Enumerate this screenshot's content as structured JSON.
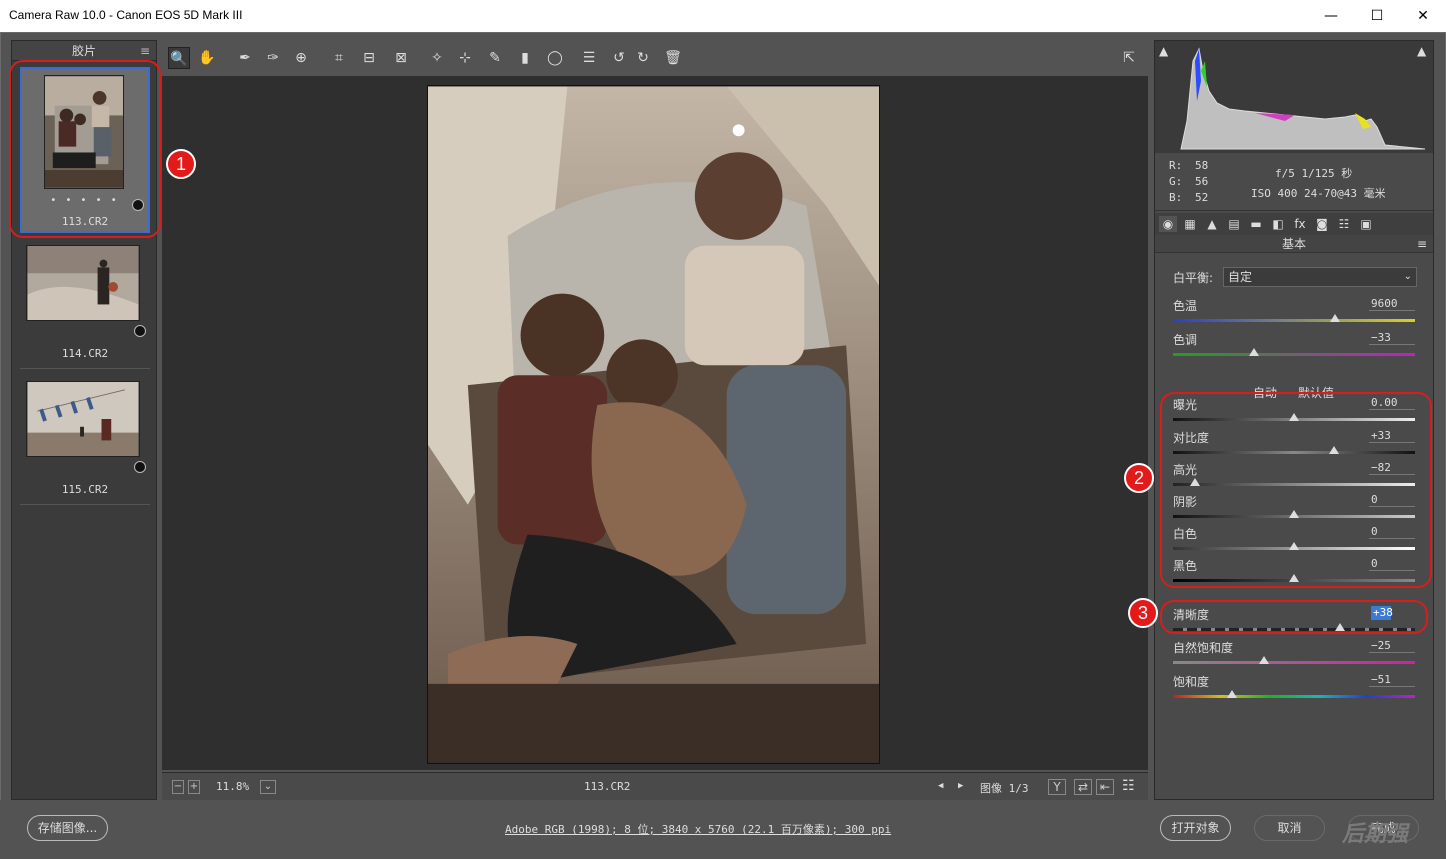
{
  "window": {
    "title": "Camera Raw 10.0 -  Canon EOS 5D Mark III",
    "minimize": "—",
    "maximize": "☐",
    "close": "✕"
  },
  "filmstrip": {
    "header": "胶片",
    "menu_icon": "≡",
    "items": [
      {
        "label": "113.CR2",
        "dots": "• • • • •"
      },
      {
        "label": "114.CR2"
      },
      {
        "label": "115.CR2"
      }
    ]
  },
  "toolbar": {
    "tools": [
      {
        "icon": "zoom-icon",
        "glyph": "🔍"
      },
      {
        "icon": "hand-icon",
        "glyph": "✋"
      },
      {
        "icon": "white-balance-icon",
        "glyph": "✒"
      },
      {
        "icon": "color-sampler-icon",
        "glyph": "✑"
      },
      {
        "icon": "targeted-adjust-icon",
        "glyph": "⊕"
      },
      {
        "icon": "crop-icon",
        "glyph": "⌗"
      },
      {
        "icon": "straighten-icon",
        "glyph": "⊟"
      },
      {
        "icon": "transform-icon",
        "glyph": "⊠"
      },
      {
        "icon": "spot-removal-icon",
        "glyph": "✧"
      },
      {
        "icon": "red-eye-icon",
        "glyph": "⊹"
      },
      {
        "icon": "adjustment-brush-icon",
        "glyph": "✎"
      },
      {
        "icon": "graduated-filter-icon",
        "glyph": "▮"
      },
      {
        "icon": "radial-filter-icon",
        "glyph": "◯"
      },
      {
        "icon": "preferences-icon",
        "glyph": "☰"
      },
      {
        "icon": "rotate-ccw-icon",
        "glyph": "↺"
      },
      {
        "icon": "rotate-cw-icon",
        "glyph": "↻"
      },
      {
        "icon": "trash-icon",
        "glyph": "🗑"
      }
    ],
    "fullscreen_glyph": "⇱"
  },
  "status": {
    "zoom_out": "−",
    "zoom_in": "+",
    "zoom": "11.8%",
    "zoom_chevron": "⌄",
    "filename": "113.CR2",
    "prev": "◀",
    "next": "▶",
    "image_counter": "图像 1/3",
    "view_y": "Y",
    "view_swap": "⇄",
    "view_copy": "⇤",
    "view_settings": "☷"
  },
  "info": {
    "r_label": "R:",
    "r": "58",
    "g_label": "G:",
    "g": "56",
    "b_label": "B:",
    "b": "52",
    "aperture_shutter": "f/5  1/125 秒",
    "iso_lens": "ISO 400  24-70@43 毫米"
  },
  "histogram_clip_left": "▲",
  "histogram_clip_right": "▲",
  "panel": {
    "tabs": [
      "◉",
      "▦",
      "▲",
      "▤",
      "▬",
      "◧",
      "fx",
      "◙",
      "☷",
      "▣"
    ],
    "title": "基本",
    "menu": "≡",
    "white_balance_label": "白平衡:",
    "white_balance_value": "自定",
    "wb_chevron": "⌄",
    "auto": "自动",
    "default": "默认值",
    "sliders": [
      {
        "name": "色温",
        "value": "9600",
        "pos": 0.67
      },
      {
        "name": "色调",
        "value": "−33",
        "pos": 0.335
      },
      {
        "name": "曝光",
        "value": "0.00",
        "pos": 0.5
      },
      {
        "name": "对比度",
        "value": "+33",
        "pos": 0.665
      },
      {
        "name": "高光",
        "value": "−82",
        "pos": 0.09
      },
      {
        "name": "阴影",
        "value": "0",
        "pos": 0.5
      },
      {
        "name": "白色",
        "value": "0",
        "pos": 0.5
      },
      {
        "name": "黑色",
        "value": "0",
        "pos": 0.5
      },
      {
        "name": "清晰度",
        "value": "+38",
        "pos": 0.69
      },
      {
        "name": "自然饱和度",
        "value": "−25",
        "pos": 0.375
      },
      {
        "name": "饱和度",
        "value": "−51",
        "pos": 0.245
      }
    ]
  },
  "bottom": {
    "save": "存储图像...",
    "workflow": "Adobe RGB (1998); 8 位; 3840 x 5760 (22.1 百万像素); 300 ppi",
    "open": "打开对象",
    "cancel": "取消",
    "done": "完成",
    "watermark": "后期强"
  },
  "callouts": [
    "1",
    "2",
    "3"
  ],
  "colors": {
    "accent": "#3d6bd1",
    "annotation": "#d81d1d",
    "highlight": "#3a7bd5"
  }
}
